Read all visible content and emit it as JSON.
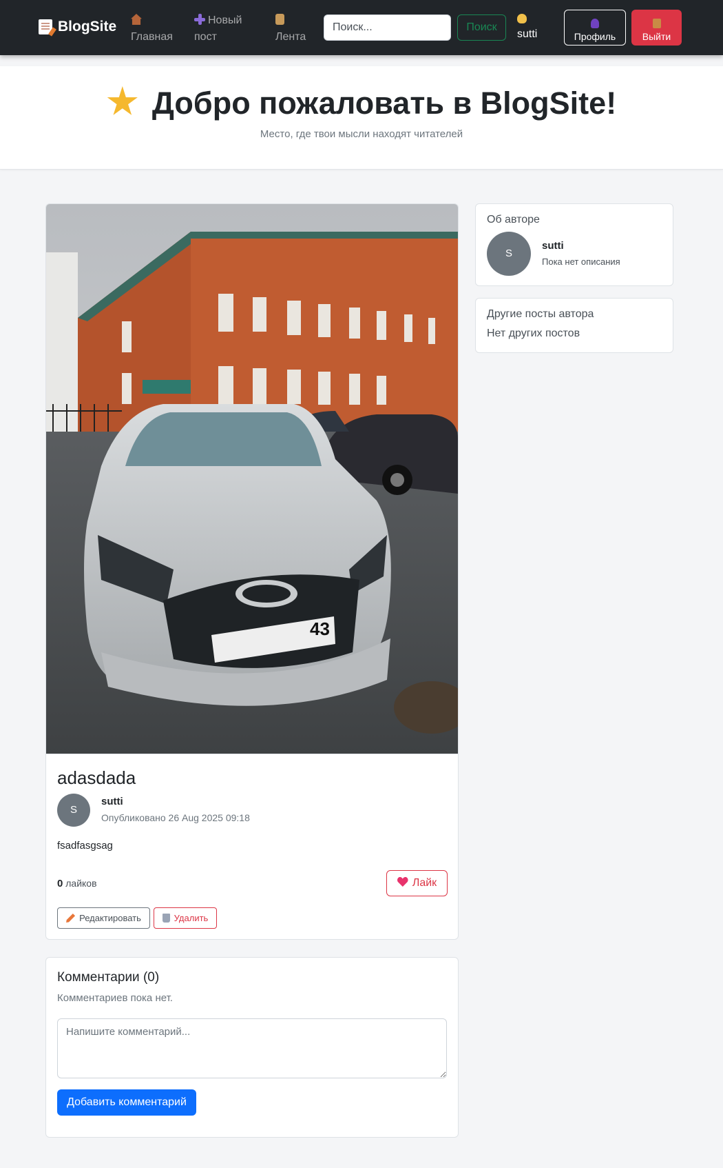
{
  "navbar": {
    "brand": "BlogSite",
    "links": [
      {
        "label": "Главная",
        "icon": "house-icon"
      },
      {
        "label": "Новый пост",
        "icon": "plus-icon"
      },
      {
        "label": "Лента",
        "icon": "scroll-icon"
      }
    ],
    "search_placeholder": "Поиск...",
    "search_button": "Поиск",
    "username": "sutti",
    "profile_button": "Профиль",
    "logout_button": "Выйти"
  },
  "hero": {
    "title": "Добро пожаловать в BlogSite!",
    "subtitle": "Место, где твои мысли находят читателей"
  },
  "post": {
    "title": "adasdada",
    "author_initial": "S",
    "author": "sutti",
    "published": "Опубликовано 26 Aug 2025 09:18",
    "body": "fsadfasgsag",
    "likes_count": "0",
    "likes_label": "лайков",
    "like_button": "Лайк",
    "edit_button": "Редактировать",
    "delete_button": "Удалить",
    "photo_plate": "43"
  },
  "comments": {
    "title": "Комментарии (0)",
    "empty": "Комментариев пока нет.",
    "placeholder": "Напишите комментарий...",
    "submit": "Добавить комментарий"
  },
  "sidebar": {
    "about_heading": "Об авторе",
    "author_initial": "S",
    "author": "sutti",
    "description": "Пока нет описания",
    "other_heading": "Другие посты автора",
    "other_empty": "Нет других постов"
  },
  "colors": {
    "navbar": "#212529",
    "danger": "#dc3545",
    "success": "#198754",
    "primary": "#0d6efd",
    "avatar": "#6c757d"
  }
}
